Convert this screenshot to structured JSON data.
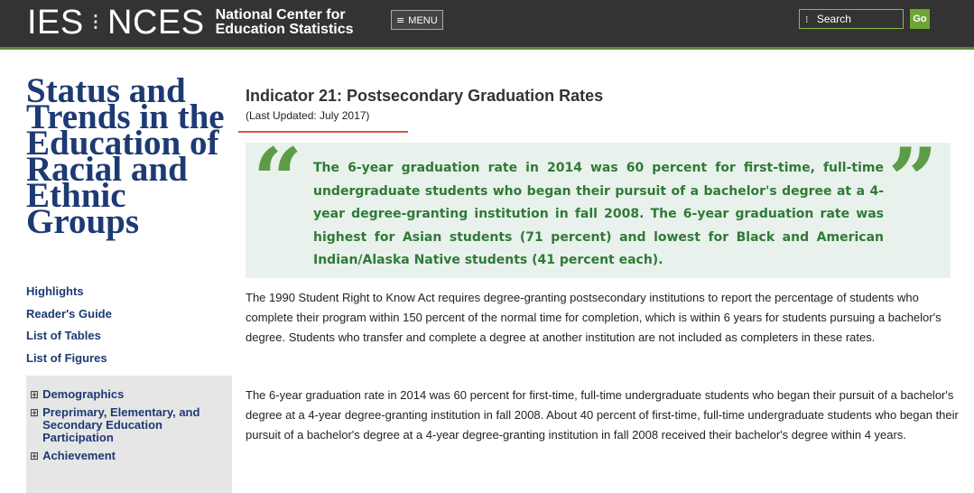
{
  "header": {
    "ies": "IES",
    "separator": "⁝",
    "nces": "NCES",
    "org_line1": "National Center for",
    "org_line2": "Education Statistics",
    "menu_label": "MENU",
    "menu_icon": "≡",
    "search_label": "Search",
    "search_icon": "⁝",
    "go_label": "Go",
    "accent_color": "#6ea535"
  },
  "sidebar": {
    "title": "Status and Trends in the Education of Racial and Ethnic Groups",
    "links": [
      "Highlights",
      "Reader's Guide",
      "List of Tables",
      "List of Figures"
    ],
    "toc_expand_icon": "⊞",
    "toc": [
      "Demographics",
      "Preprimary, Elementary, and Secondary Education Participation",
      "Achievement"
    ]
  },
  "main": {
    "title": "Indicator 21: Postsecondary Graduation Rates",
    "updated": "(Last Updated: July 2017)",
    "quote_open": "“",
    "quote_close": "”",
    "highlight": "The 6-year graduation rate in 2014 was 60 percent for first-time, full-time undergraduate students who began their pursuit of a bachelor's degree at a 4-year degree-granting institution in fall 2008. The 6-year graduation rate was highest for Asian students (71 percent) and lowest for Black and American Indian/Alaska Native students (41 percent each).",
    "paragraphs": [
      "The 1990 Student Right to Know Act requires degree-granting postsecondary institutions to report the percentage of students who complete their program within 150 percent of the normal time for completion, which is within 6 years for students pursuing a bachelor's degree. Students who transfer and complete a degree at another institution are not included as completers in these rates.",
      "The 6-year graduation rate in 2014 was 60 percent for first-time, full-time undergraduate students who began their pursuit of a bachelor's degree at a 4-year degree-granting institution in fall 2008. About 40 percent of first-time, full-time undergraduate students who began their pursuit of a bachelor's degree at a 4-year degree-granting institution in fall 2008 received their bachelor's degree within 4 years."
    ]
  }
}
